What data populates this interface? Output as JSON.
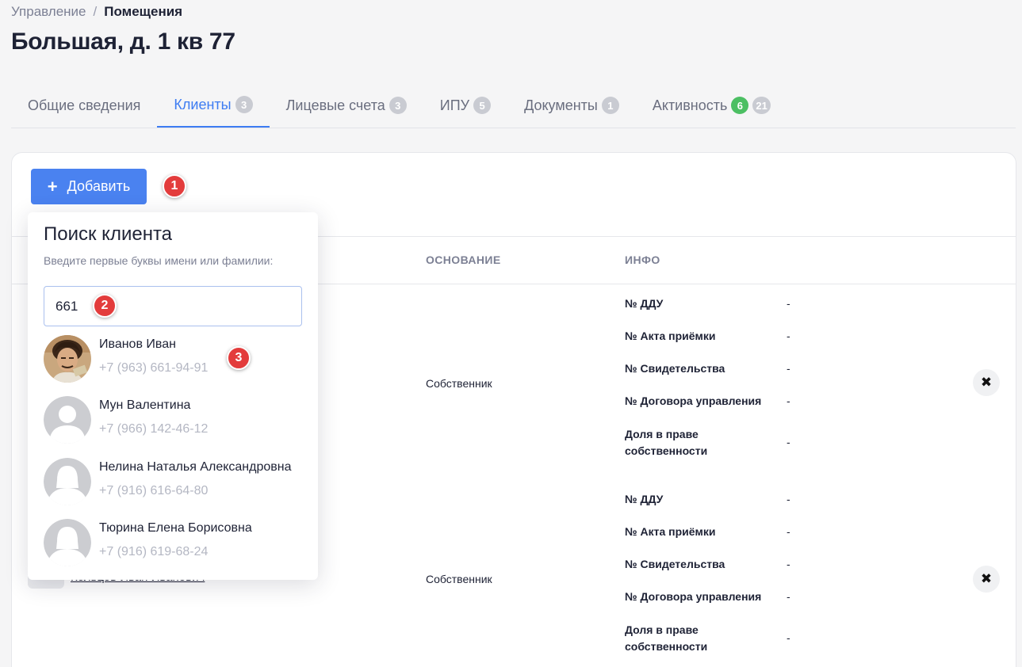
{
  "breadcrumb": {
    "parent": "Управление",
    "separator": "/",
    "current": "Помещения"
  },
  "page_title": "Большая, д. 1 кв 77",
  "tabs": [
    {
      "label": "Общие сведения",
      "badges": []
    },
    {
      "label": "Клиенты",
      "badges": [
        "3"
      ]
    },
    {
      "label": "Лицевые счета",
      "badges": [
        "3"
      ]
    },
    {
      "label": "ИПУ",
      "badges": [
        "5"
      ]
    },
    {
      "label": "Документы",
      "badges": [
        "1"
      ]
    },
    {
      "label": "Активность",
      "badges": [
        "6",
        "21"
      ]
    }
  ],
  "colors": {
    "accent": "#3d7cf2",
    "button": "#4a82f0",
    "badge_green": "#4cbf63",
    "marker": "#e33c3c"
  },
  "toolbar": {
    "add_label": "Добавить",
    "add_icon": "plus-icon"
  },
  "markers": [
    "1",
    "2",
    "3"
  ],
  "table": {
    "headers": {
      "basis": "ОСНОВАНИЕ",
      "info": "ИНФО"
    },
    "rows": [
      {
        "basis": "Собственник",
        "info": [
          {
            "label": "№ ДДУ",
            "value": "-"
          },
          {
            "label": "№ Акта приёмки",
            "value": "-"
          },
          {
            "label": "№ Свидетельства",
            "value": "-"
          },
          {
            "label": "№ Договора управления",
            "value": "-"
          },
          {
            "label": "Доля в праве собственности",
            "value": "-"
          }
        ]
      },
      {
        "basis": "Собственник",
        "client_name": "Кольцов Иван Иванович",
        "info": [
          {
            "label": "№ ДДУ",
            "value": "-"
          },
          {
            "label": "№ Акта приёмки",
            "value": "-"
          },
          {
            "label": "№ Свидетельства",
            "value": "-"
          },
          {
            "label": "№ Договора управления",
            "value": "-"
          },
          {
            "label": "Доля в праве собственности",
            "value": "-"
          }
        ]
      }
    ],
    "delete_icon": "close-icon"
  },
  "search_popup": {
    "title": "Поиск клиента",
    "hint": "Введите первые буквы имени или фамилии:",
    "query": "661",
    "results": [
      {
        "name": "Иванов Иван",
        "phone": "+7 (963) 661-94-91",
        "avatar": "photo"
      },
      {
        "name": "Мун Валентина",
        "phone": "+7 (966) 142-46-12",
        "avatar": "male-placeholder"
      },
      {
        "name": "Нелина Наталья Александровна",
        "phone": "+7 (916) 616-64-80",
        "avatar": "female-placeholder"
      },
      {
        "name": "Тюрина Елена Борисовна",
        "phone": "+7 (916) 619-68-24",
        "avatar": "female-placeholder"
      }
    ]
  }
}
